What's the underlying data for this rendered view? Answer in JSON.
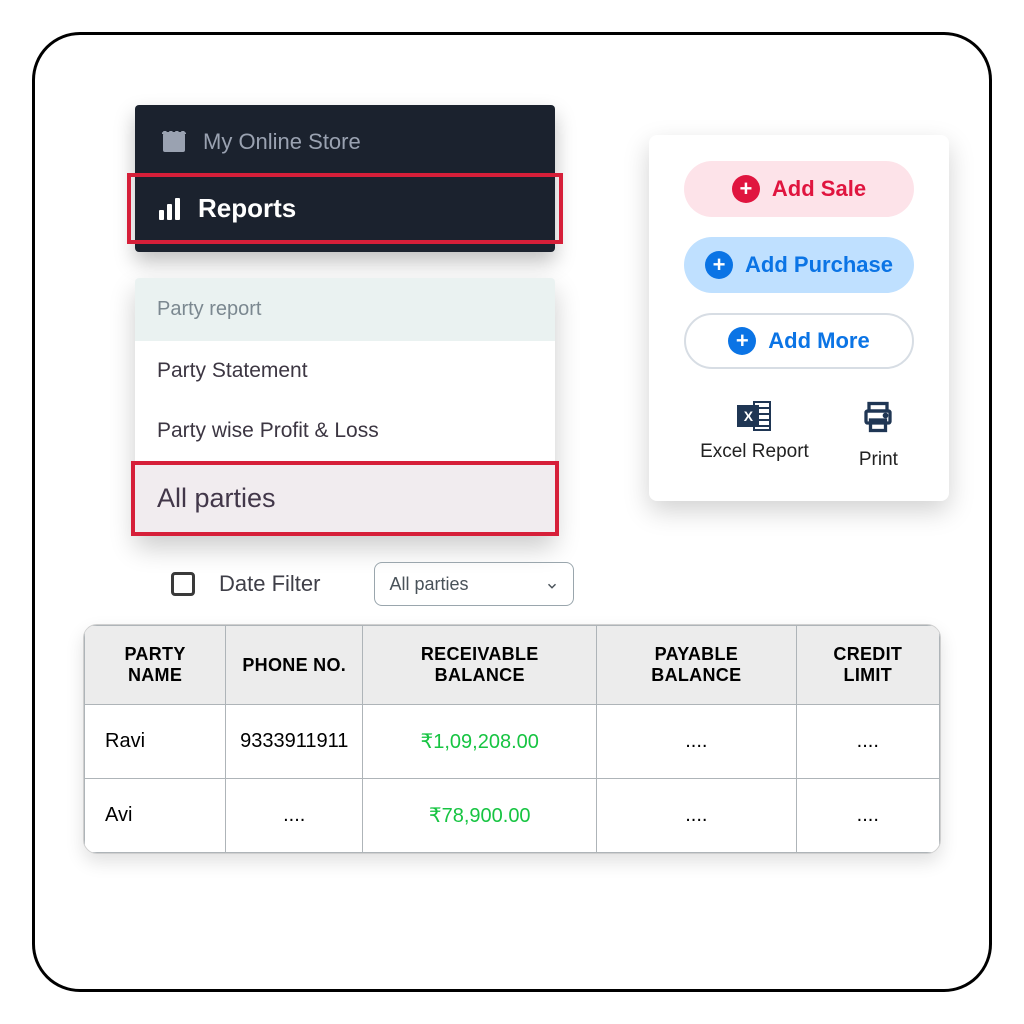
{
  "sidebar": {
    "store_label": "My Online Store",
    "reports_label": "Reports"
  },
  "submenu": {
    "header": "Party report",
    "items": [
      {
        "label": "Party Statement"
      },
      {
        "label": "Party wise Profit & Loss"
      },
      {
        "label": "All parties"
      }
    ]
  },
  "actions": {
    "add_sale": "Add Sale",
    "add_purchase": "Add Purchase",
    "add_more": "Add More",
    "excel": "Excel Report",
    "print": "Print"
  },
  "filter": {
    "date_label": "Date Filter",
    "dropdown_value": "All parties"
  },
  "table": {
    "headers": {
      "party": "PARTY NAME",
      "phone": "PHONE NO.",
      "receivable": "RECEIVABLE BALANCE",
      "payable": "PAYABLE BALANCE",
      "credit": "CREDIT LIMIT"
    },
    "rows": [
      {
        "name": "Ravi",
        "phone": "9333911911",
        "receivable": "₹1,09,208.00",
        "payable": "....",
        "credit": "...."
      },
      {
        "name": "Avi",
        "phone": "....",
        "receivable": "₹78,900.00",
        "payable": "....",
        "credit": "...."
      }
    ]
  }
}
